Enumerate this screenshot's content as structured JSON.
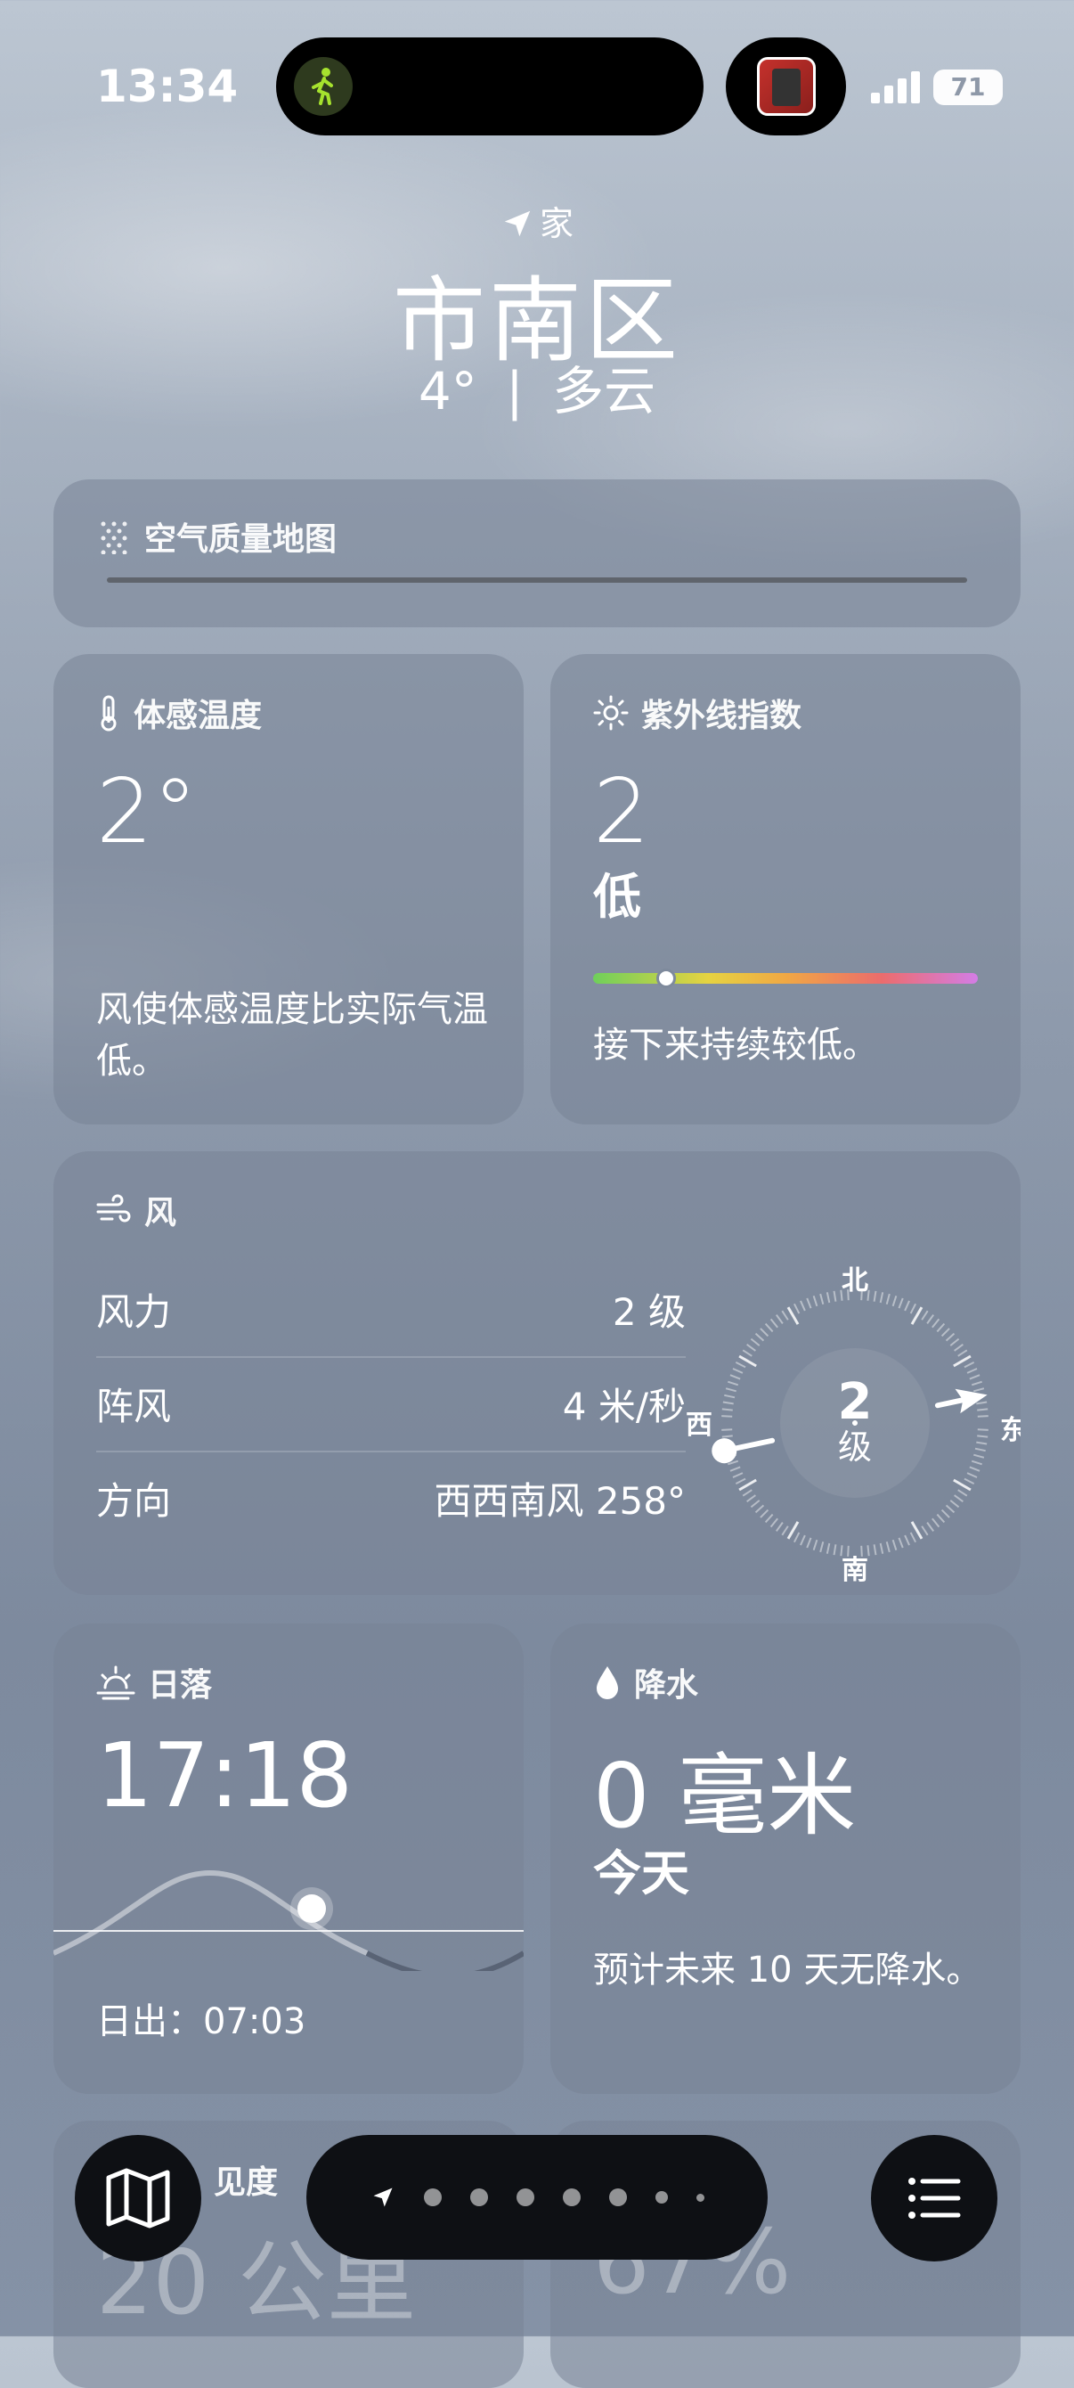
{
  "status_bar": {
    "time": "13:34",
    "battery": "71"
  },
  "location": {
    "label": "家",
    "city": "市南区",
    "temperature": "4°",
    "condition": "多云",
    "separator": "|"
  },
  "air_quality": {
    "title": "空气质量地图"
  },
  "feels_like": {
    "title": "体感温度",
    "value": "2°",
    "description": "风使体感温度比实际气温低。"
  },
  "uv_index": {
    "title": "紫外线指数",
    "value": "2",
    "level": "低",
    "description": "接下来持续较低。",
    "position": 0.19
  },
  "wind": {
    "title": "风",
    "rows": [
      {
        "label": "风力",
        "value": "2 级"
      },
      {
        "label": "阵风",
        "value": "4 米/秒"
      },
      {
        "label": "方向",
        "value": "西西南风 258°"
      }
    ],
    "compass": {
      "north": "北",
      "south": "南",
      "east": "东",
      "west": "西",
      "speed": "2",
      "unit": "级",
      "direction_deg": 258
    }
  },
  "sunset": {
    "title": "日落",
    "time": "17:18",
    "sunrise": "日出：07:03"
  },
  "precipitation": {
    "title": "降水",
    "amount": "0 毫米",
    "period": "今天",
    "description": "预计未来 10 天无降水。"
  },
  "partial_cards": {
    "visibility_title": "见度",
    "visibility_value": "20 公里",
    "humidity_value": "67%"
  },
  "colors": {
    "uv_start": "#6fcf5b",
    "uv_end": "#d37de6",
    "island": "#000000",
    "walk_icon": "#a6e22e"
  }
}
